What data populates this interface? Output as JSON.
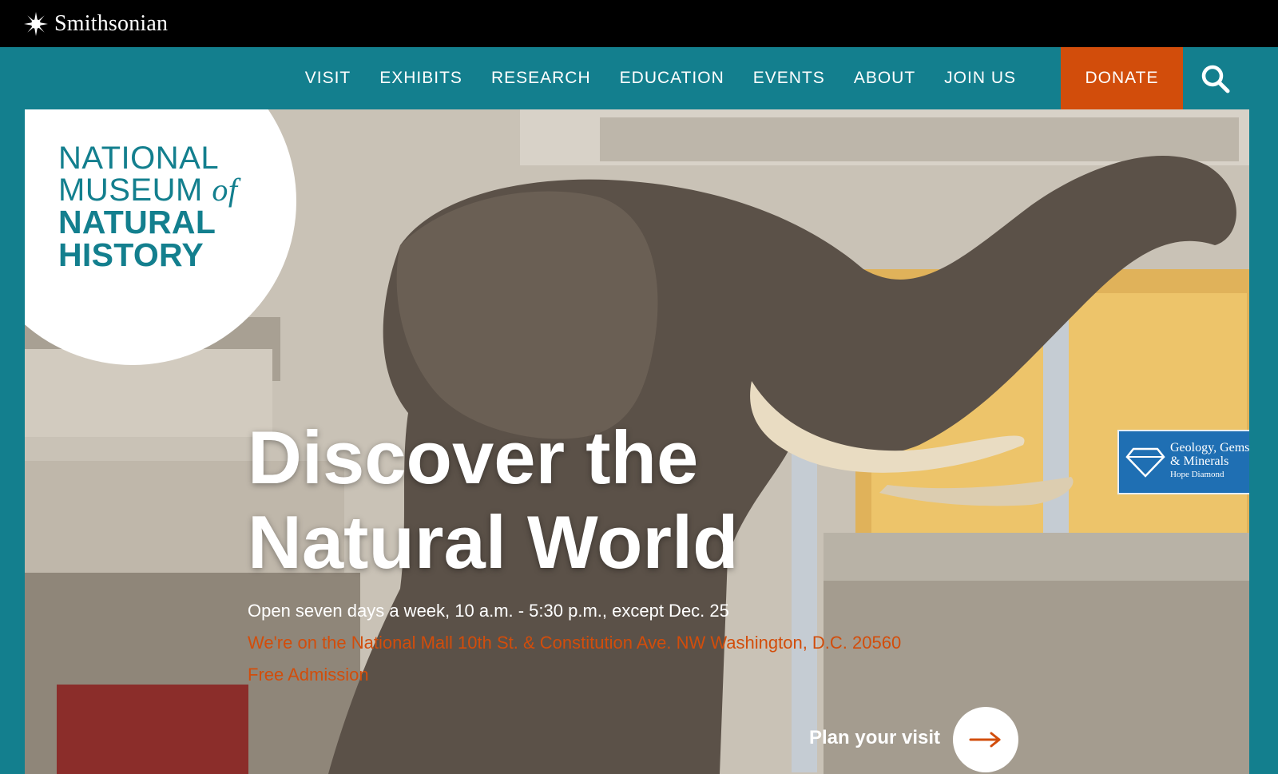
{
  "brand": {
    "smithsonian": "Smithsonian"
  },
  "nav": {
    "items": [
      "VISIT",
      "EXHIBITS",
      "RESEARCH",
      "EDUCATION",
      "EVENTS",
      "ABOUT",
      "JOIN US"
    ],
    "donate": "DONATE",
    "search_icon": "search-icon"
  },
  "badge": {
    "line1": "NATIONAL",
    "line2": "MUSEUM",
    "line2_italic": "of",
    "line3": "NATURAL",
    "line4": "HISTORY"
  },
  "hero": {
    "title_line1": "Discover the",
    "title_line2": "Natural World",
    "hours": "Open seven days a week, 10 a.m. - 5:30 p.m., except Dec. 25",
    "address": "We're on the National Mall 10th St. & Constitution Ave. NW Washington, D.C. 20560",
    "admission": "Free Admission",
    "cta": "Plan your visit",
    "sign_line1": "Geology, Gems",
    "sign_line2": "& Minerals",
    "sign_line3": "Hope Diamond"
  },
  "colors": {
    "teal": "#137f8e",
    "orange": "#d24d0b",
    "black": "#000000"
  }
}
